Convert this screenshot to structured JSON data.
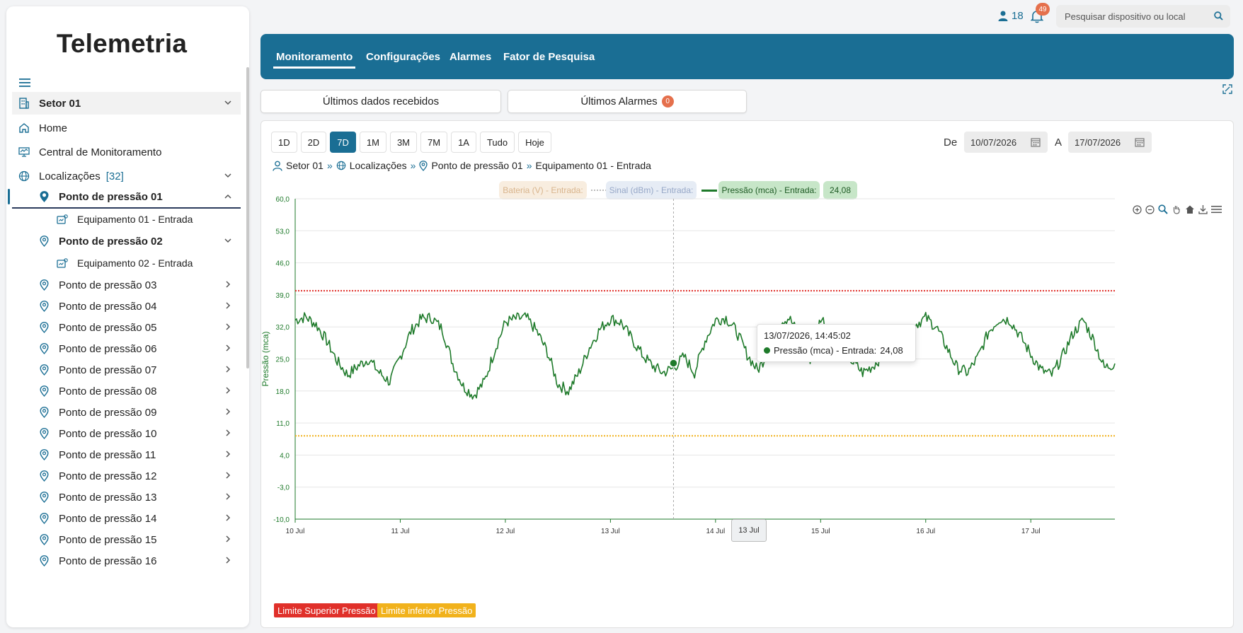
{
  "app": {
    "title": "Telemetria"
  },
  "sidebar": {
    "sector": "Setor 01",
    "home": "Home",
    "central": "Central de Monitoramento",
    "localizacoes": "Localizações",
    "localizacoes_count": "[32]",
    "points": [
      {
        "label": "Ponto de pressão 01",
        "equipment": "Equipamento 01 - Entrada",
        "expanded": true,
        "active": true
      },
      {
        "label": "Ponto de pressão 02",
        "equipment": "Equipamento 02 - Entrada",
        "expanded": true,
        "active": false
      },
      {
        "label": "Ponto de pressão 03"
      },
      {
        "label": "Ponto de pressão 04"
      },
      {
        "label": "Ponto de pressão 05"
      },
      {
        "label": "Ponto de pressão 06"
      },
      {
        "label": "Ponto de pressão 07"
      },
      {
        "label": "Ponto de pressão 08"
      },
      {
        "label": "Ponto de pressão 09"
      },
      {
        "label": "Ponto de pressão 10"
      },
      {
        "label": "Ponto de pressão 11"
      },
      {
        "label": "Ponto de pressão 12"
      },
      {
        "label": "Ponto de pressão 13"
      },
      {
        "label": "Ponto de pressão 14"
      },
      {
        "label": "Ponto de pressão 15"
      },
      {
        "label": "Ponto de pressão 16"
      }
    ]
  },
  "header": {
    "users_count": "18",
    "notifications_count": "49",
    "search_placeholder": "Pesquisar dispositivo ou local"
  },
  "tabs": [
    "Monitoramento",
    "Configurações",
    "Alarmes",
    "Fator de Pesquisa"
  ],
  "active_tab": "Monitoramento",
  "subtabs": {
    "ultimos_dados": "Últimos dados recebidos",
    "ultimos_alarmes": "Últimos Alarmes",
    "alarm_count": "0"
  },
  "range_buttons": [
    "1D",
    "2D",
    "7D",
    "1M",
    "3M",
    "7M",
    "1A",
    "Tudo",
    "Hoje"
  ],
  "active_range": "7D",
  "date_filter": {
    "from_label": "De",
    "from": "10/07/2026",
    "to_label": "A",
    "to": "17/07/2026"
  },
  "breadcrumb": [
    "Setor 01",
    "Localizações",
    "Ponto de pressão 01",
    "Equipamento 01 - Entrada"
  ],
  "legend": {
    "battery": "Bateria (V) - Entrada:",
    "signal": "Sinal (dBm) - Entrada:",
    "pressure": "Pressão (mca) - Entrada:",
    "pressure_value": "24,08"
  },
  "tooltip": {
    "date": "13/07/2026, 14:45:02",
    "series": "Pressão (mca) - Entrada:",
    "value": "24,08"
  },
  "cursor_label": "13 Jul",
  "limit_legend": {
    "upper": "Limite Superior Pressão",
    "lower": "Limite inferior Pressão"
  },
  "colors": {
    "accent": "#1a6e94",
    "series": "#1e7a2a",
    "upper_limit": "#e0302a",
    "lower_limit": "#f1b21c",
    "badge": "#e5704c"
  },
  "chart_data": {
    "type": "line",
    "ylabel": "Pressão (mca)",
    "ylim": [
      -10,
      60
    ],
    "yticks": [
      "60,0",
      "53,0",
      "46,0",
      "39,0",
      "32,0",
      "25,0",
      "18,0",
      "11,0",
      "4,0",
      "-3,0",
      "-10,0"
    ],
    "xticks": [
      "10 Jul",
      "11 Jul",
      "12 Jul",
      "13 Jul",
      "14 Jul",
      "15 Jul",
      "16 Jul",
      "17 Jul"
    ],
    "xlim_days": [
      10,
      17.8
    ],
    "grid": true,
    "upper_limit": 39.9,
    "lower_limit": 8.2,
    "series": [
      {
        "name": "Pressão (mca) - Entrada",
        "x_days": [
          10.0,
          10.1,
          10.2,
          10.3,
          10.4,
          10.5,
          10.6,
          10.7,
          10.8,
          10.9,
          11.0,
          11.1,
          11.2,
          11.3,
          11.4,
          11.5,
          11.6,
          11.7,
          11.8,
          11.9,
          12.0,
          12.1,
          12.2,
          12.3,
          12.4,
          12.5,
          12.6,
          12.7,
          12.8,
          12.9,
          13.0,
          13.1,
          13.2,
          13.3,
          13.4,
          13.5,
          13.6,
          13.7,
          13.8,
          13.9,
          14.0,
          14.1,
          14.2,
          14.3,
          14.4,
          14.5,
          14.6,
          14.7,
          14.8,
          14.9,
          15.0,
          15.1,
          15.2,
          15.3,
          15.4,
          15.5,
          15.6,
          15.7,
          15.8,
          15.9,
          16.0,
          16.1,
          16.2,
          16.3,
          16.4,
          16.5,
          16.6,
          16.7,
          16.8,
          16.9,
          17.0,
          17.1,
          17.2,
          17.3,
          17.4,
          17.5,
          17.6,
          17.7,
          17.8
        ],
        "values": [
          33.5,
          34.2,
          32.5,
          29.0,
          24.5,
          21.5,
          23.5,
          25.0,
          22.0,
          20.0,
          25.5,
          31.0,
          33.8,
          34.0,
          31.5,
          24.0,
          19.0,
          17.0,
          20.0,
          27.0,
          33.0,
          33.8,
          34.0,
          31.0,
          26.5,
          19.5,
          18.0,
          22.0,
          27.5,
          31.5,
          33.8,
          33.0,
          29.5,
          26.0,
          23.5,
          22.0,
          23.0,
          25.5,
          22.0,
          29.0,
          33.5,
          34.0,
          31.0,
          26.0,
          22.5,
          26.5,
          33.0,
          34.0,
          30.0,
          25.0,
          34.0,
          31.5,
          28.0,
          24.5,
          22.0,
          23.5,
          26.0,
          28.5,
          30.5,
          32.5,
          34.0,
          32.0,
          27.5,
          23.0,
          22.0,
          25.5,
          31.0,
          33.8,
          33.5,
          30.0,
          26.0,
          22.5,
          21.5,
          25.5,
          30.5,
          33.5,
          29.0,
          23.0,
          24.0
        ]
      }
    ],
    "highlight_point": {
      "x_days": 13.6,
      "value": 24.08
    }
  }
}
